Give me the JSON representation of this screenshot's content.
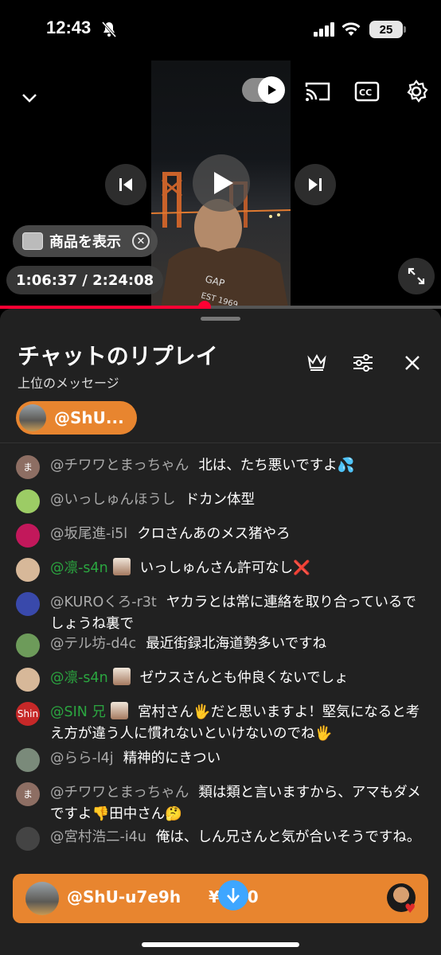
{
  "status_bar": {
    "time": "12:43",
    "battery": "25"
  },
  "player": {
    "product_chip": "商品を表示",
    "timecode": "1:06:37 / 2:24:08",
    "progress_fraction": 0.463,
    "colors": {
      "progress": "#ff0033"
    }
  },
  "chat": {
    "title": "チャットのリプレイ",
    "subtitle": "上位のメッセージ",
    "pinned_name": "@ShU...",
    "messages": [
      {
        "avatar_text": "ま",
        "avatar_color": "#8d6e63",
        "author": "@チワワとまっちゃん",
        "text": "北は、たち悪いですよ💦",
        "green": false
      },
      {
        "avatar_text": "",
        "avatar_color": "#9ccc65",
        "author": "@いっしゅんほうし",
        "text": "ドカン体型",
        "green": false
      },
      {
        "avatar_text": "",
        "avatar_color": "#c2185b",
        "author": "@坂尾進-i5l",
        "text": "クロさんあのメス猪やろ",
        "green": false
      },
      {
        "avatar_text": "",
        "avatar_color": "#d7b899",
        "author": "@凛-s4n",
        "text": "いっしゅんさん許可なし❌",
        "green": true,
        "badge": true
      },
      {
        "avatar_text": "",
        "avatar_color": "#3949ab",
        "author": "@KUROくろ-r3t",
        "text": "ヤカラとは常に連絡を取り合っているでしょうね裏で",
        "green": false
      },
      {
        "avatar_text": "",
        "avatar_color": "#6d9b5a",
        "author": "@テル坊-d4c",
        "text": "最近街録北海道勢多いですね",
        "green": false
      },
      {
        "avatar_text": "",
        "avatar_color": "#d7b899",
        "author": "@凛-s4n",
        "text": "ゼウスさんとも仲良くないでしょ",
        "green": true,
        "badge": true
      },
      {
        "avatar_text": "Shin",
        "avatar_color": "#c62828",
        "author": "@SIN 兄",
        "text": "宮村さん🖐️だと思いますよ！堅気になると考え方が違う人に慣れないといけないのでね🖐️",
        "green": true,
        "badge": true
      },
      {
        "avatar_text": "",
        "avatar_color": "#7a8a7a",
        "author": "@らら-l4j",
        "text": "精神的にきつい",
        "green": false
      },
      {
        "avatar_text": "ま",
        "avatar_color": "#8d6e63",
        "author": "@チワワとまっちゃん",
        "text": "類は類と言いますから、アマもダメですよ👎田中さん🤔",
        "green": false
      },
      {
        "avatar_text": "",
        "avatar_color": "#444444",
        "author": "@宮村浩二-i4u",
        "text": "俺は、しん兄さんと気が合いそうですね。",
        "green": false
      }
    ]
  },
  "superchat": {
    "name": "@ShU-u7e9h",
    "amount": "¥  000",
    "color": "#e8852f"
  }
}
